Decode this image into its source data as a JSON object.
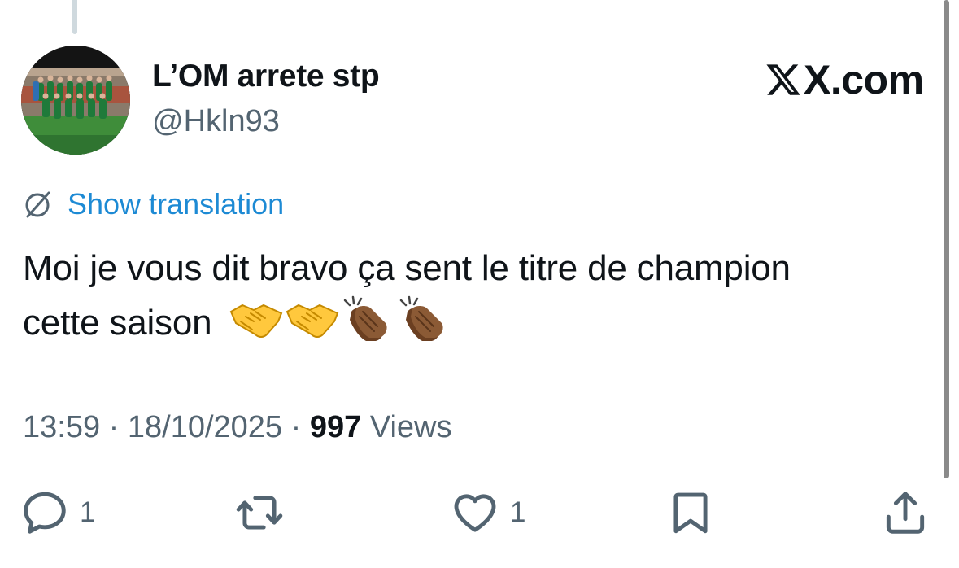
{
  "tweet": {
    "display_name": "L’OM arrete stp",
    "handle": "@Hkln93",
    "brand": "X.com",
    "show_translation": "Show translation",
    "text_line1": "Moi je vous dit bravo ça sent le titre de champion",
    "text_line2": "cette saison",
    "emojis": [
      "handshake",
      "handshake",
      "clapping-hands-medium-dark",
      "clapping-hands-medium-dark"
    ],
    "time": "13:59",
    "date": "18/10/2025",
    "views_count": "997",
    "views_label": "Views",
    "separator": "·"
  },
  "actions": {
    "reply_count": "1",
    "retweet_count": "",
    "like_count": "1"
  },
  "icons": {
    "translate": "globe-slash-icon",
    "reply": "speech-bubble-icon",
    "retweet": "retweet-arrows-icon",
    "like": "heart-outline-icon",
    "bookmark": "bookmark-icon",
    "share": "share-upload-icon"
  },
  "colors": {
    "text": "#0f1419",
    "secondary": "#536471",
    "link": "#1d8ad4",
    "icon": "#536471"
  }
}
